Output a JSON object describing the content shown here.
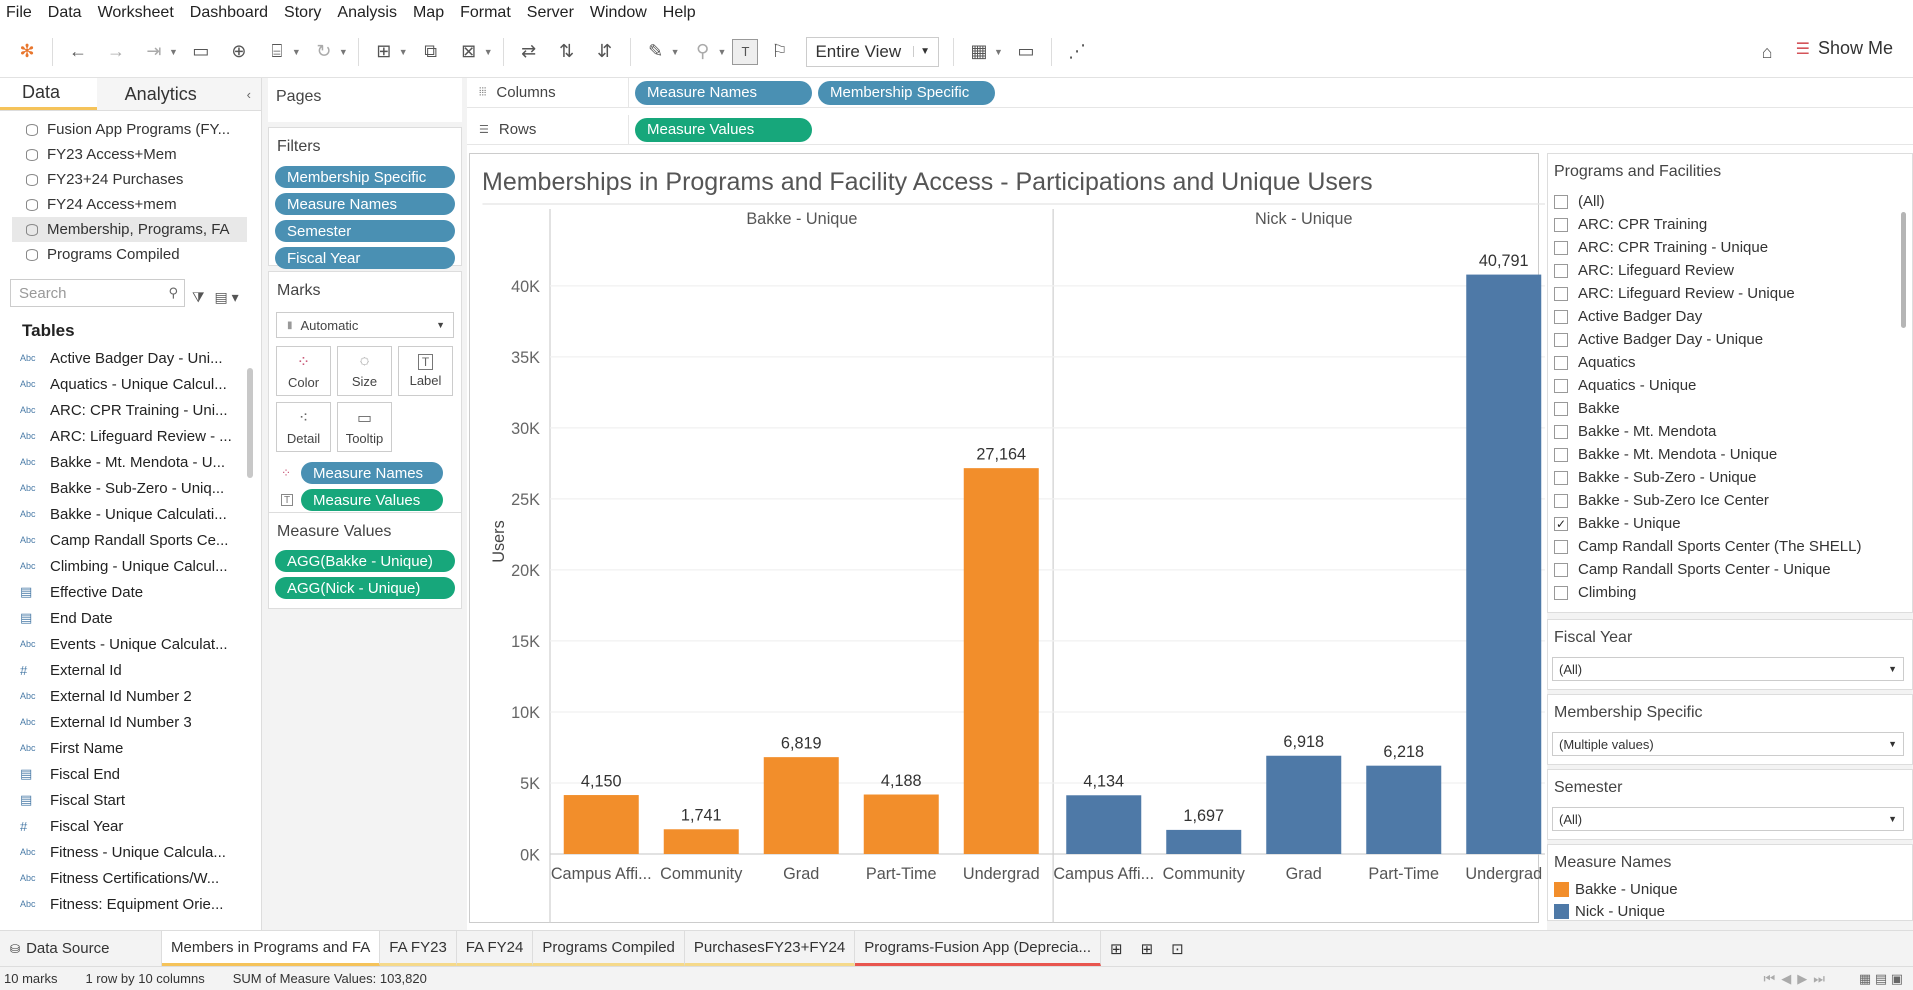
{
  "menu": [
    "File",
    "Data",
    "Worksheet",
    "Dashboard",
    "Story",
    "Analysis",
    "Map",
    "Format",
    "Server",
    "Window",
    "Help"
  ],
  "toolbar": {
    "view_mode": "Entire View",
    "show_me": "Show Me"
  },
  "left_pane": {
    "tabs": [
      "Data",
      "Analytics"
    ],
    "data_sources": [
      "Fusion App Programs (FY...",
      "FY23 Access+Mem",
      "FY23+24 Purchases",
      "FY24 Access+mem",
      "Membership, Programs, FA",
      "Programs Compiled"
    ],
    "search_placeholder": "Search",
    "tables_heading": "Tables",
    "fields": [
      {
        "type": "Abc",
        "name": "Active Badger Day - Uni..."
      },
      {
        "type": "Abc",
        "name": "Aquatics - Unique Calcul..."
      },
      {
        "type": "Abc",
        "name": "ARC: CPR Training - Uni..."
      },
      {
        "type": "Abc",
        "name": "ARC: Lifeguard Review - ..."
      },
      {
        "type": "Abc",
        "name": "Bakke - Mt. Mendota - U..."
      },
      {
        "type": "Abc",
        "name": "Bakke - Sub-Zero - Uniq..."
      },
      {
        "type": "Abc",
        "name": "Bakke - Unique Calculati..."
      },
      {
        "type": "Abc",
        "name": "Camp Randall Sports Ce..."
      },
      {
        "type": "Abc",
        "name": "Climbing - Unique Calcul..."
      },
      {
        "type": "date",
        "name": "Effective Date"
      },
      {
        "type": "date",
        "name": "End Date"
      },
      {
        "type": "Abc",
        "name": "Events - Unique Calculat..."
      },
      {
        "type": "#",
        "name": "External Id"
      },
      {
        "type": "Abc",
        "name": "External Id Number 2"
      },
      {
        "type": "Abc",
        "name": "External Id Number 3"
      },
      {
        "type": "Abc",
        "name": "First Name"
      },
      {
        "type": "date",
        "name": "Fiscal End"
      },
      {
        "type": "date",
        "name": "Fiscal Start"
      },
      {
        "type": "#",
        "name": "Fiscal Year"
      },
      {
        "type": "Abc",
        "name": "Fitness - Unique Calcula..."
      },
      {
        "type": "Abc",
        "name": "Fitness Certifications/W..."
      },
      {
        "type": "Abc",
        "name": "Fitness: Equipment Orie..."
      }
    ]
  },
  "shelves": {
    "pages_title": "Pages",
    "filters_title": "Filters",
    "filters": [
      "Membership Specific",
      "Measure Names",
      "Semester",
      "Fiscal Year"
    ],
    "marks_title": "Marks",
    "mark_type": "Automatic",
    "mark_buttons": [
      "Color",
      "Size",
      "Label",
      "Detail",
      "Tooltip"
    ],
    "mark_pills": [
      "Measure Names",
      "Measure Values"
    ],
    "measure_values_title": "Measure Values",
    "measure_values": [
      "AGG(Bakke - Unique)",
      "AGG(Nick - Unique)"
    ],
    "columns_label": "Columns",
    "columns": [
      "Measure Names",
      "Membership Specific"
    ],
    "rows_label": "Rows",
    "rows": [
      "Measure Values"
    ]
  },
  "viz": {
    "title": "Memberships in Programs and Facility Access - Participations and Unique Users"
  },
  "chart_data": {
    "type": "bar",
    "title": "Memberships in Programs and Facility Access - Participations and Unique Users",
    "ylabel": "Users",
    "xlabel": "",
    "ylim": [
      0,
      44000
    ],
    "yticks": [
      "0K",
      "5K",
      "10K",
      "15K",
      "20K",
      "25K",
      "30K",
      "35K",
      "40K"
    ],
    "categories": [
      "Campus Affi...",
      "Community",
      "Grad",
      "Part-Time",
      "Undergrad"
    ],
    "series": [
      {
        "name": "Bakke - Unique",
        "color": "#f28e2b",
        "values": [
          4150,
          1741,
          6819,
          4188,
          27164
        ],
        "labels": [
          "4,150",
          "1,741",
          "6,819",
          "4,188",
          "27,164"
        ]
      },
      {
        "name": "Nick - Unique",
        "color": "#4e79a7",
        "values": [
          4134,
          1697,
          6918,
          6218,
          40791
        ],
        "labels": [
          "4,134",
          "1,697",
          "6,918",
          "6,218",
          "40,791"
        ]
      }
    ],
    "grid": true
  },
  "right_pane": {
    "programs_title": "Programs and Facilities",
    "programs": [
      {
        "label": "(All)",
        "checked": false
      },
      {
        "label": "ARC: CPR Training",
        "checked": false
      },
      {
        "label": "ARC: CPR Training - Unique",
        "checked": false
      },
      {
        "label": "ARC: Lifeguard Review",
        "checked": false
      },
      {
        "label": "ARC: Lifeguard Review - Unique",
        "checked": false
      },
      {
        "label": "Active Badger Day",
        "checked": false
      },
      {
        "label": "Active Badger Day - Unique",
        "checked": false
      },
      {
        "label": "Aquatics",
        "checked": false
      },
      {
        "label": "Aquatics - Unique",
        "checked": false
      },
      {
        "label": "Bakke",
        "checked": false
      },
      {
        "label": "Bakke - Mt. Mendota",
        "checked": false
      },
      {
        "label": "Bakke - Mt. Mendota - Unique",
        "checked": false
      },
      {
        "label": "Bakke - Sub-Zero - Unique",
        "checked": false
      },
      {
        "label": "Bakke - Sub-Zero Ice Center",
        "checked": false
      },
      {
        "label": "Bakke - Unique",
        "checked": true
      },
      {
        "label": "Camp Randall Sports Center (The SHELL)",
        "checked": false
      },
      {
        "label": "Camp Randall Sports Center - Unique",
        "checked": false
      },
      {
        "label": "Climbing",
        "checked": false
      }
    ],
    "check_mark": "✓",
    "fiscal_year_title": "Fiscal Year",
    "fiscal_year_value": "(All)",
    "membership_title": "Membership Specific",
    "membership_value": "(Multiple values)",
    "semester_title": "Semester",
    "semester_value": "(All)",
    "legend_title": "Measure Names",
    "legend": [
      {
        "label": "Bakke - Unique",
        "color": "#f28e2b"
      },
      {
        "label": "Nick - Unique",
        "color": "#4e79a7"
      }
    ]
  },
  "sheet_tabs": [
    "Data Source",
    "Members in Programs and FA",
    "FA FY23",
    "FA FY24",
    "Programs Compiled",
    "PurchasesFY23+FY24",
    "Programs-Fusion App (Deprecia..."
  ],
  "status": {
    "marks": "10 marks",
    "dims": "1 row by 10 columns",
    "sum": "SUM of Measure Values: 103,820"
  }
}
